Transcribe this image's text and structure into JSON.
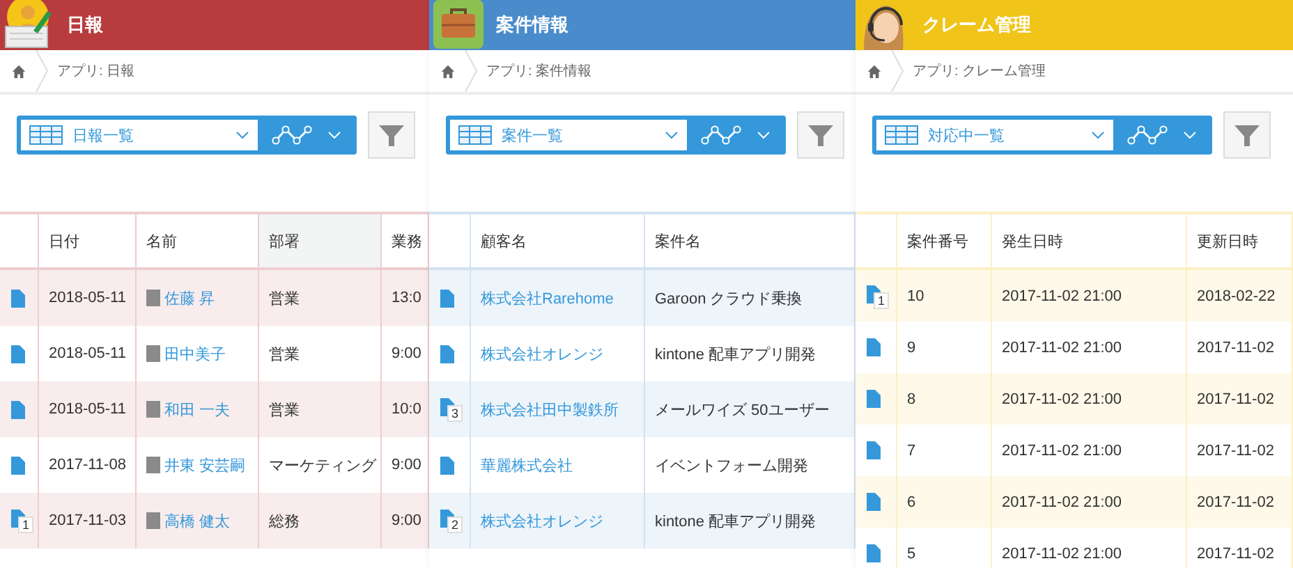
{
  "panels": [
    {
      "kind": "report",
      "title": "日報",
      "color": "#b83c3e",
      "breadcrumb": "アプリ: 日報",
      "view": "日報一覧",
      "columns": [
        {
          "label": "日付",
          "sorted": false
        },
        {
          "label": "名前",
          "sorted": false
        },
        {
          "label": "部署",
          "sorted": true
        },
        {
          "label": "業務",
          "sorted": false
        }
      ],
      "rows": [
        {
          "comments": "",
          "cells": [
            {
              "kind": "text",
              "text": "2018-05-11"
            },
            {
              "kind": "person",
              "text": "佐藤 昇"
            },
            {
              "kind": "text",
              "text": "営業"
            },
            {
              "kind": "text",
              "text": "13:0"
            }
          ]
        },
        {
          "comments": "",
          "cells": [
            {
              "kind": "text",
              "text": "2018-05-11"
            },
            {
              "kind": "person",
              "text": "田中美子"
            },
            {
              "kind": "text",
              "text": "営業"
            },
            {
              "kind": "text",
              "text": "9:00"
            }
          ]
        },
        {
          "comments": "",
          "cells": [
            {
              "kind": "text",
              "text": "2018-05-11"
            },
            {
              "kind": "person",
              "text": "和田 一夫"
            },
            {
              "kind": "text",
              "text": "営業"
            },
            {
              "kind": "text",
              "text": "10:0"
            }
          ]
        },
        {
          "comments": "",
          "cells": [
            {
              "kind": "text",
              "text": "2017-11-08"
            },
            {
              "kind": "person",
              "text": "井東 安芸嗣"
            },
            {
              "kind": "text",
              "text": "マーケティング"
            },
            {
              "kind": "text",
              "text": "9:00"
            }
          ]
        },
        {
          "comments": "1",
          "cells": [
            {
              "kind": "text",
              "text": "2017-11-03"
            },
            {
              "kind": "person",
              "text": "高橋 健太"
            },
            {
              "kind": "text",
              "text": "総務"
            },
            {
              "kind": "text",
              "text": "9:00"
            }
          ]
        }
      ]
    },
    {
      "kind": "briefcase",
      "title": "案件情報",
      "color": "#4a8ccb",
      "breadcrumb": "アプリ: 案件情報",
      "view": "案件一覧",
      "columns": [
        {
          "label": "顧客名",
          "sorted": false
        },
        {
          "label": "案件名",
          "sorted": false
        }
      ],
      "rows": [
        {
          "comments": "",
          "cells": [
            {
              "kind": "link",
              "text": "株式会社Rarehome"
            },
            {
              "kind": "text",
              "text": "Garoon クラウド乗換"
            }
          ]
        },
        {
          "comments": "",
          "cells": [
            {
              "kind": "link",
              "text": "株式会社オレンジ"
            },
            {
              "kind": "text",
              "text": "kintone 配車アプリ開発"
            }
          ]
        },
        {
          "comments": "3",
          "cells": [
            {
              "kind": "link",
              "text": "株式会社田中製鉄所"
            },
            {
              "kind": "text",
              "text": "メールワイズ 50ユーザー"
            }
          ]
        },
        {
          "comments": "",
          "cells": [
            {
              "kind": "link",
              "text": "華麗株式会社"
            },
            {
              "kind": "text",
              "text": "イベントフォーム開発"
            }
          ]
        },
        {
          "comments": "2",
          "cells": [
            {
              "kind": "link",
              "text": "株式会社オレンジ"
            },
            {
              "kind": "text",
              "text": "kintone 配車アプリ開発"
            }
          ]
        }
      ]
    },
    {
      "kind": "headset",
      "title": "クレーム管理",
      "color": "#f0c419",
      "breadcrumb": "アプリ: クレーム管理",
      "view": "対応中一覧",
      "columns": [
        {
          "label": "案件番号",
          "sorted": false
        },
        {
          "label": "発生日時",
          "sorted": false
        },
        {
          "label": "更新日時",
          "sorted": false
        }
      ],
      "rows": [
        {
          "comments": "1",
          "cells": [
            {
              "kind": "text",
              "text": "10"
            },
            {
              "kind": "text",
              "text": "2017-11-02 21:00"
            },
            {
              "kind": "text",
              "text": "2018-02-22"
            }
          ]
        },
        {
          "comments": "",
          "cells": [
            {
              "kind": "text",
              "text": "9"
            },
            {
              "kind": "text",
              "text": "2017-11-02 21:00"
            },
            {
              "kind": "text",
              "text": "2017-11-02"
            }
          ]
        },
        {
          "comments": "",
          "cells": [
            {
              "kind": "text",
              "text": "8"
            },
            {
              "kind": "text",
              "text": "2017-11-02 21:00"
            },
            {
              "kind": "text",
              "text": "2017-11-02"
            }
          ]
        },
        {
          "comments": "",
          "cells": [
            {
              "kind": "text",
              "text": "7"
            },
            {
              "kind": "text",
              "text": "2017-11-02 21:00"
            },
            {
              "kind": "text",
              "text": "2017-11-02"
            }
          ]
        },
        {
          "comments": "",
          "cells": [
            {
              "kind": "text",
              "text": "6"
            },
            {
              "kind": "text",
              "text": "2017-11-02 21:00"
            },
            {
              "kind": "text",
              "text": "2017-11-02"
            }
          ]
        },
        {
          "comments": "",
          "cells": [
            {
              "kind": "text",
              "text": "5"
            },
            {
              "kind": "text",
              "text": "2017-11-02 21:00"
            },
            {
              "kind": "text",
              "text": "2017-11-02"
            }
          ]
        }
      ]
    }
  ]
}
